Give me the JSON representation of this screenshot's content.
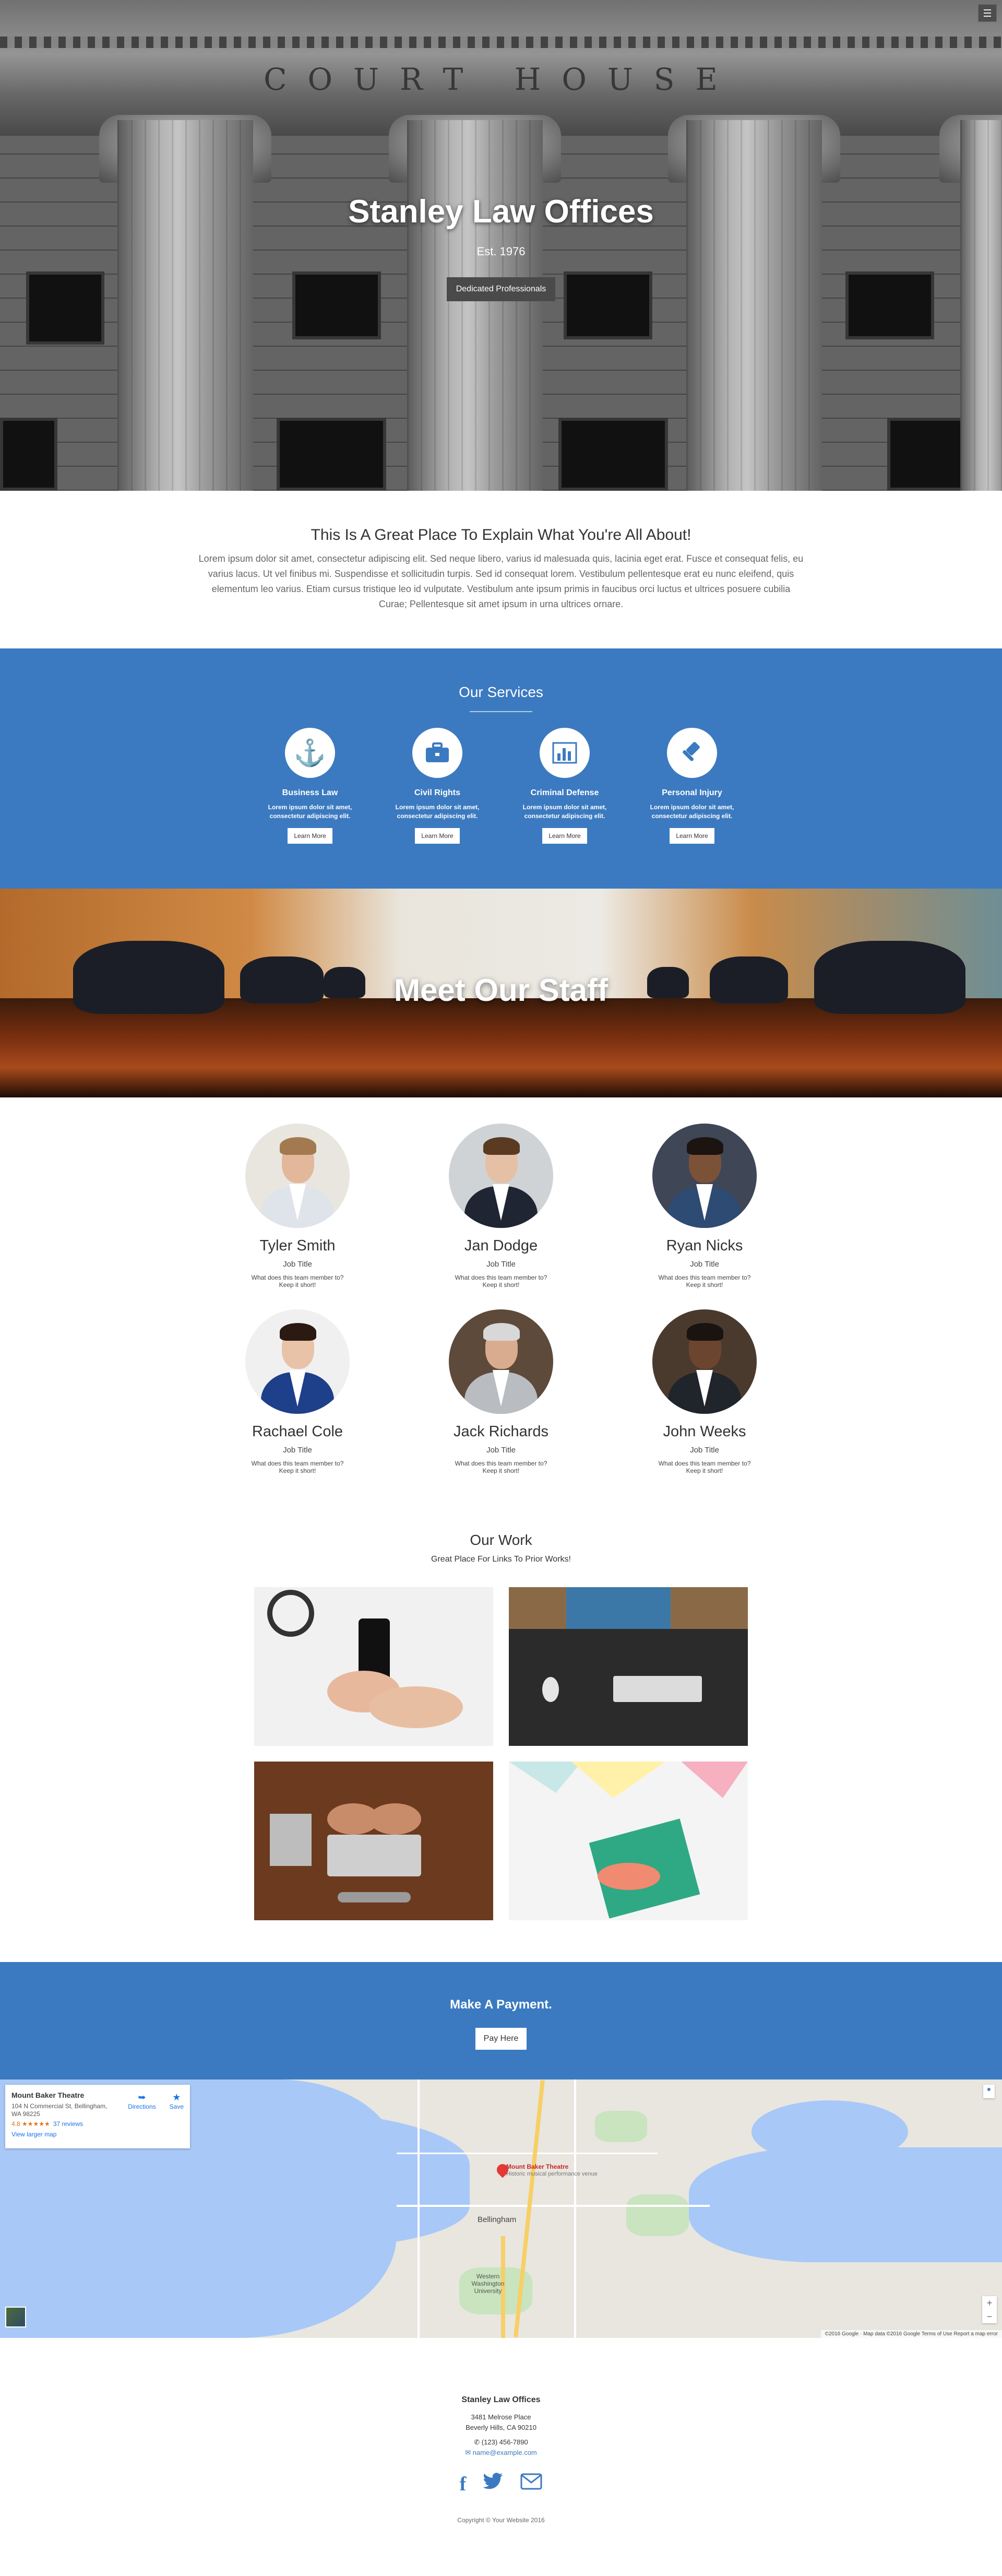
{
  "hero": {
    "inscription": "COURT HOUSE",
    "title": "Stanley Law Offices",
    "established": "Est. 1976",
    "tagline_button": "Dedicated Professionals"
  },
  "intro": {
    "heading": "This Is A Great Place To Explain What You're All About!",
    "body": "Lorem ipsum dolor sit amet, consectetur adipiscing elit. Sed neque libero, varius id malesuada quis, lacinia eget erat. Fusce et consequat felis, eu varius lacus. Ut vel finibus mi. Suspendisse et sollicitudin turpis. Sed id consequat lorem. Vestibulum pellentesque erat eu nunc eleifend, quis elementum leo varius. Etiam cursus tristique leo id vulputate. Vestibulum ante ipsum primis in faucibus orci luctus et ultrices posuere cubilia Curae; Pellentesque sit amet ipsum in urna ultrices ornare."
  },
  "services": {
    "heading": "Our Services",
    "items": [
      {
        "title": "Business Law",
        "text": "Lorem ipsum dolor sit amet, consectetur adipiscing elit.",
        "button": "Learn More",
        "icon": "anchor-icon"
      },
      {
        "title": "Civil Rights",
        "text": "Lorem ipsum dolor sit amet, consectetur adipiscing elit.",
        "button": "Learn More",
        "icon": "briefcase-icon"
      },
      {
        "title": "Criminal Defense",
        "text": "Lorem ipsum dolor sit amet, consectetur adipiscing elit.",
        "button": "Learn More",
        "icon": "bar-chart-icon"
      },
      {
        "title": "Personal Injury",
        "text": "Lorem ipsum dolor sit amet, consectetur adipiscing elit.",
        "button": "Learn More",
        "icon": "gavel-icon"
      }
    ]
  },
  "staff_banner": {
    "heading": "Meet Our Staff"
  },
  "staff": {
    "members": [
      {
        "name": "Tyler Smith",
        "role": "Job Title",
        "bio": "What does this team member to? Keep it short!"
      },
      {
        "name": "Jan Dodge",
        "role": "Job Title",
        "bio": "What does this team member to? Keep it short!"
      },
      {
        "name": "Ryan Nicks",
        "role": "Job Title",
        "bio": "What does this team member to? Keep it short!"
      },
      {
        "name": "Rachael Cole",
        "role": "Job Title",
        "bio": "What does this team member to? Keep it short!"
      },
      {
        "name": "Jack Richards",
        "role": "Job Title",
        "bio": "What does this team member to? Keep it short!"
      },
      {
        "name": "John Weeks",
        "role": "Job Title",
        "bio": "What does this team member to? Keep it short!"
      }
    ]
  },
  "work": {
    "heading": "Our Work",
    "subheading": "Great Place For Links To Prior Works!"
  },
  "payment": {
    "heading": "Make A Payment.",
    "button": "Pay Here"
  },
  "map": {
    "place_name": "Mount Baker Theatre",
    "address": "104 N Commercial St, Bellingham, WA 98225",
    "rating": "4.8 ★★★★★",
    "reviews": "37 reviews",
    "larger_map": "View larger map",
    "directions": "Directions",
    "save": "Save",
    "pin_title": "Mount Baker Theatre",
    "pin_subtitle": "Historic musical performance venue",
    "city_label": "Bellingham",
    "university_label": "Western Washington University",
    "footer_text": "©2016 Google · Map data ©2016 Google   Terms of Use   Report a map error"
  },
  "footer": {
    "name": "Stanley Law Offices",
    "address_line1": "3481 Melrose Place",
    "address_line2": "Beverly Hills, CA 90210",
    "phone": "(123) 456-7890",
    "email": "name@example.com",
    "copyright": "Copyright © Your Website 2016"
  },
  "colors": {
    "accent": "#3b7ac0",
    "hero_button": "#4a4a4a"
  }
}
